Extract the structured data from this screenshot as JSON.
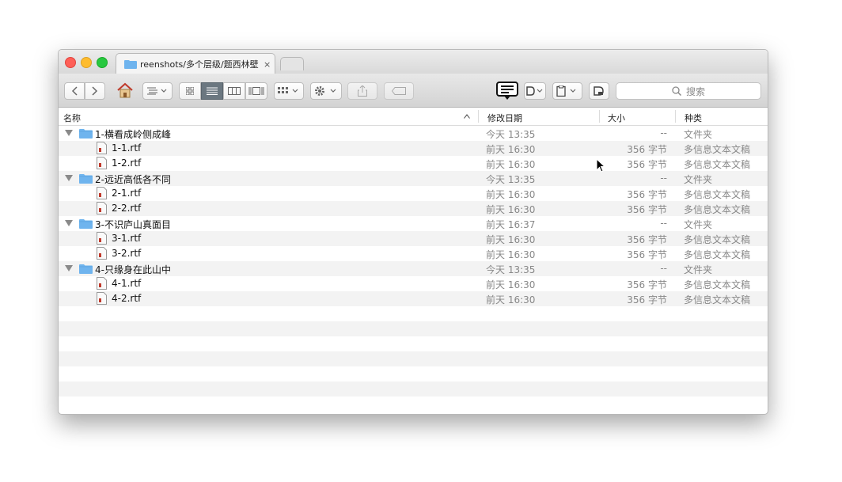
{
  "tab": {
    "title": "reenshots/多个层级/题西林壁",
    "close": "×"
  },
  "search": {
    "placeholder": "搜索",
    "icon": "search-icon"
  },
  "columns": {
    "name": "名称",
    "date": "修改日期",
    "size": "大小",
    "kind": "种类"
  },
  "rows": [
    {
      "kind_type": "folder",
      "name": "1-横看成岭侧成峰",
      "date": "今天 13:35",
      "size": "--",
      "kind": "文件夹"
    },
    {
      "kind_type": "file",
      "name": "1-1.rtf",
      "date": "前天 16:30",
      "size": "356 字节",
      "kind": "多信息文本文稿"
    },
    {
      "kind_type": "file",
      "name": "1-2.rtf",
      "date": "前天 16:30",
      "size": "356 字节",
      "kind": "多信息文本文稿"
    },
    {
      "kind_type": "folder",
      "name": "2-远近高低各不同",
      "date": "今天 13:35",
      "size": "--",
      "kind": "文件夹"
    },
    {
      "kind_type": "file",
      "name": "2-1.rtf",
      "date": "前天 16:30",
      "size": "356 字节",
      "kind": "多信息文本文稿"
    },
    {
      "kind_type": "file",
      "name": "2-2.rtf",
      "date": "前天 16:30",
      "size": "356 字节",
      "kind": "多信息文本文稿"
    },
    {
      "kind_type": "folder",
      "name": "3-不识庐山真面目",
      "date": "前天 16:37",
      "size": "--",
      "kind": "文件夹"
    },
    {
      "kind_type": "file",
      "name": "3-1.rtf",
      "date": "前天 16:30",
      "size": "356 字节",
      "kind": "多信息文本文稿"
    },
    {
      "kind_type": "file",
      "name": "3-2.rtf",
      "date": "前天 16:30",
      "size": "356 字节",
      "kind": "多信息文本文稿"
    },
    {
      "kind_type": "folder",
      "name": "4-只缘身在此山中",
      "date": "今天 13:35",
      "size": "--",
      "kind": "文件夹"
    },
    {
      "kind_type": "file",
      "name": "4-1.rtf",
      "date": "前天 16:30",
      "size": "356 字节",
      "kind": "多信息文本文稿"
    },
    {
      "kind_type": "file",
      "name": "4-2.rtf",
      "date": "前天 16:30",
      "size": "356 字节",
      "kind": "多信息文本文稿"
    }
  ],
  "empty_rows": 7,
  "colors": {
    "folder": "#6fb4ee",
    "active_view": "#6b7780",
    "row_alt": "#f3f3f3"
  }
}
